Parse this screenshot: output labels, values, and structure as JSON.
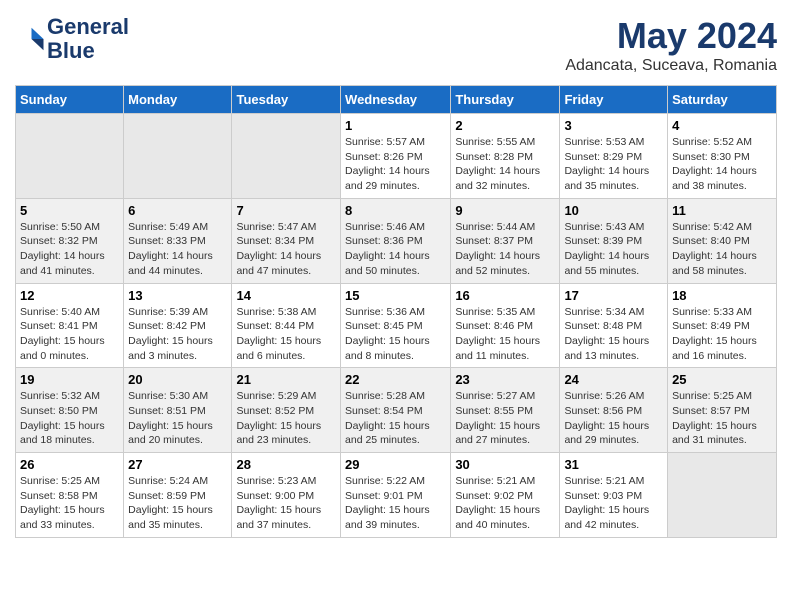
{
  "header": {
    "logo_line1": "General",
    "logo_line2": "Blue",
    "month": "May 2024",
    "location": "Adancata, Suceava, Romania"
  },
  "weekdays": [
    "Sunday",
    "Monday",
    "Tuesday",
    "Wednesday",
    "Thursday",
    "Friday",
    "Saturday"
  ],
  "weeks": [
    [
      {
        "day": "",
        "info": ""
      },
      {
        "day": "",
        "info": ""
      },
      {
        "day": "",
        "info": ""
      },
      {
        "day": "1",
        "info": "Sunrise: 5:57 AM\nSunset: 8:26 PM\nDaylight: 14 hours\nand 29 minutes."
      },
      {
        "day": "2",
        "info": "Sunrise: 5:55 AM\nSunset: 8:28 PM\nDaylight: 14 hours\nand 32 minutes."
      },
      {
        "day": "3",
        "info": "Sunrise: 5:53 AM\nSunset: 8:29 PM\nDaylight: 14 hours\nand 35 minutes."
      },
      {
        "day": "4",
        "info": "Sunrise: 5:52 AM\nSunset: 8:30 PM\nDaylight: 14 hours\nand 38 minutes."
      }
    ],
    [
      {
        "day": "5",
        "info": "Sunrise: 5:50 AM\nSunset: 8:32 PM\nDaylight: 14 hours\nand 41 minutes."
      },
      {
        "day": "6",
        "info": "Sunrise: 5:49 AM\nSunset: 8:33 PM\nDaylight: 14 hours\nand 44 minutes."
      },
      {
        "day": "7",
        "info": "Sunrise: 5:47 AM\nSunset: 8:34 PM\nDaylight: 14 hours\nand 47 minutes."
      },
      {
        "day": "8",
        "info": "Sunrise: 5:46 AM\nSunset: 8:36 PM\nDaylight: 14 hours\nand 50 minutes."
      },
      {
        "day": "9",
        "info": "Sunrise: 5:44 AM\nSunset: 8:37 PM\nDaylight: 14 hours\nand 52 minutes."
      },
      {
        "day": "10",
        "info": "Sunrise: 5:43 AM\nSunset: 8:39 PM\nDaylight: 14 hours\nand 55 minutes."
      },
      {
        "day": "11",
        "info": "Sunrise: 5:42 AM\nSunset: 8:40 PM\nDaylight: 14 hours\nand 58 minutes."
      }
    ],
    [
      {
        "day": "12",
        "info": "Sunrise: 5:40 AM\nSunset: 8:41 PM\nDaylight: 15 hours\nand 0 minutes."
      },
      {
        "day": "13",
        "info": "Sunrise: 5:39 AM\nSunset: 8:42 PM\nDaylight: 15 hours\nand 3 minutes."
      },
      {
        "day": "14",
        "info": "Sunrise: 5:38 AM\nSunset: 8:44 PM\nDaylight: 15 hours\nand 6 minutes."
      },
      {
        "day": "15",
        "info": "Sunrise: 5:36 AM\nSunset: 8:45 PM\nDaylight: 15 hours\nand 8 minutes."
      },
      {
        "day": "16",
        "info": "Sunrise: 5:35 AM\nSunset: 8:46 PM\nDaylight: 15 hours\nand 11 minutes."
      },
      {
        "day": "17",
        "info": "Sunrise: 5:34 AM\nSunset: 8:48 PM\nDaylight: 15 hours\nand 13 minutes."
      },
      {
        "day": "18",
        "info": "Sunrise: 5:33 AM\nSunset: 8:49 PM\nDaylight: 15 hours\nand 16 minutes."
      }
    ],
    [
      {
        "day": "19",
        "info": "Sunrise: 5:32 AM\nSunset: 8:50 PM\nDaylight: 15 hours\nand 18 minutes."
      },
      {
        "day": "20",
        "info": "Sunrise: 5:30 AM\nSunset: 8:51 PM\nDaylight: 15 hours\nand 20 minutes."
      },
      {
        "day": "21",
        "info": "Sunrise: 5:29 AM\nSunset: 8:52 PM\nDaylight: 15 hours\nand 23 minutes."
      },
      {
        "day": "22",
        "info": "Sunrise: 5:28 AM\nSunset: 8:54 PM\nDaylight: 15 hours\nand 25 minutes."
      },
      {
        "day": "23",
        "info": "Sunrise: 5:27 AM\nSunset: 8:55 PM\nDaylight: 15 hours\nand 27 minutes."
      },
      {
        "day": "24",
        "info": "Sunrise: 5:26 AM\nSunset: 8:56 PM\nDaylight: 15 hours\nand 29 minutes."
      },
      {
        "day": "25",
        "info": "Sunrise: 5:25 AM\nSunset: 8:57 PM\nDaylight: 15 hours\nand 31 minutes."
      }
    ],
    [
      {
        "day": "26",
        "info": "Sunrise: 5:25 AM\nSunset: 8:58 PM\nDaylight: 15 hours\nand 33 minutes."
      },
      {
        "day": "27",
        "info": "Sunrise: 5:24 AM\nSunset: 8:59 PM\nDaylight: 15 hours\nand 35 minutes."
      },
      {
        "day": "28",
        "info": "Sunrise: 5:23 AM\nSunset: 9:00 PM\nDaylight: 15 hours\nand 37 minutes."
      },
      {
        "day": "29",
        "info": "Sunrise: 5:22 AM\nSunset: 9:01 PM\nDaylight: 15 hours\nand 39 minutes."
      },
      {
        "day": "30",
        "info": "Sunrise: 5:21 AM\nSunset: 9:02 PM\nDaylight: 15 hours\nand 40 minutes."
      },
      {
        "day": "31",
        "info": "Sunrise: 5:21 AM\nSunset: 9:03 PM\nDaylight: 15 hours\nand 42 minutes."
      },
      {
        "day": "",
        "info": ""
      }
    ]
  ]
}
